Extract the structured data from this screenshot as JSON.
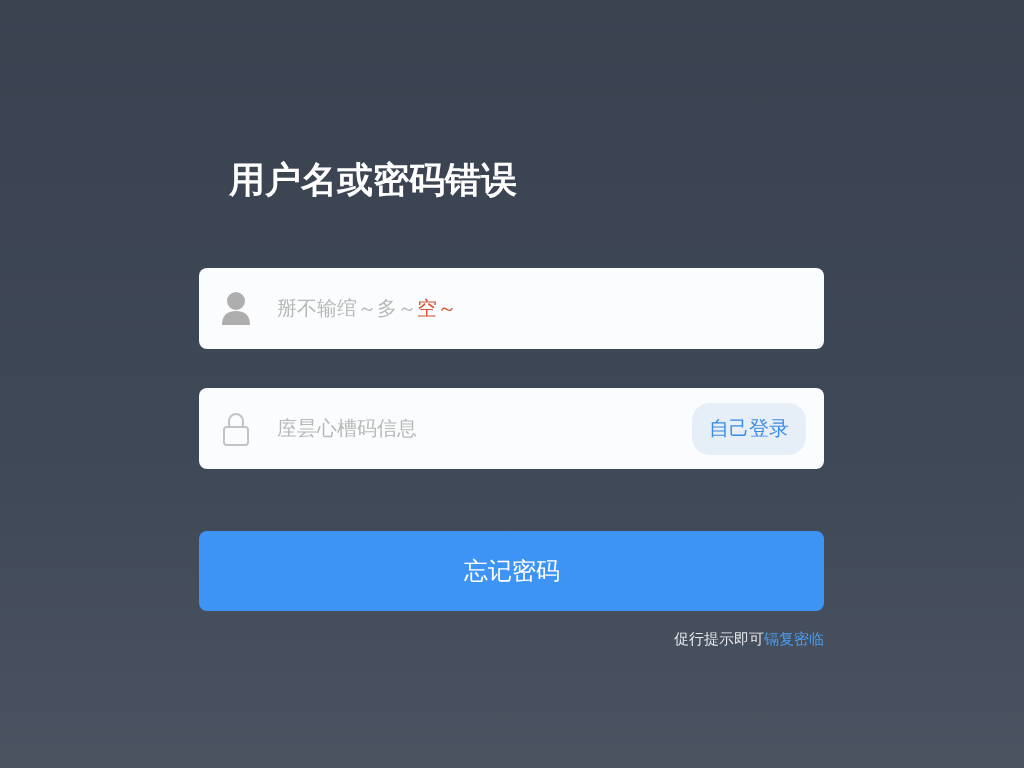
{
  "title": "用户名或密码错误",
  "username": {
    "hint": "掰不输绾～多～",
    "hint_emphasis": "空～"
  },
  "password": {
    "hint": "庢昙心槽码信息",
    "action": "自己登录"
  },
  "submit": "忘记密码",
  "footer": {
    "text": "促行提示即可",
    "link": "镉复密临"
  }
}
